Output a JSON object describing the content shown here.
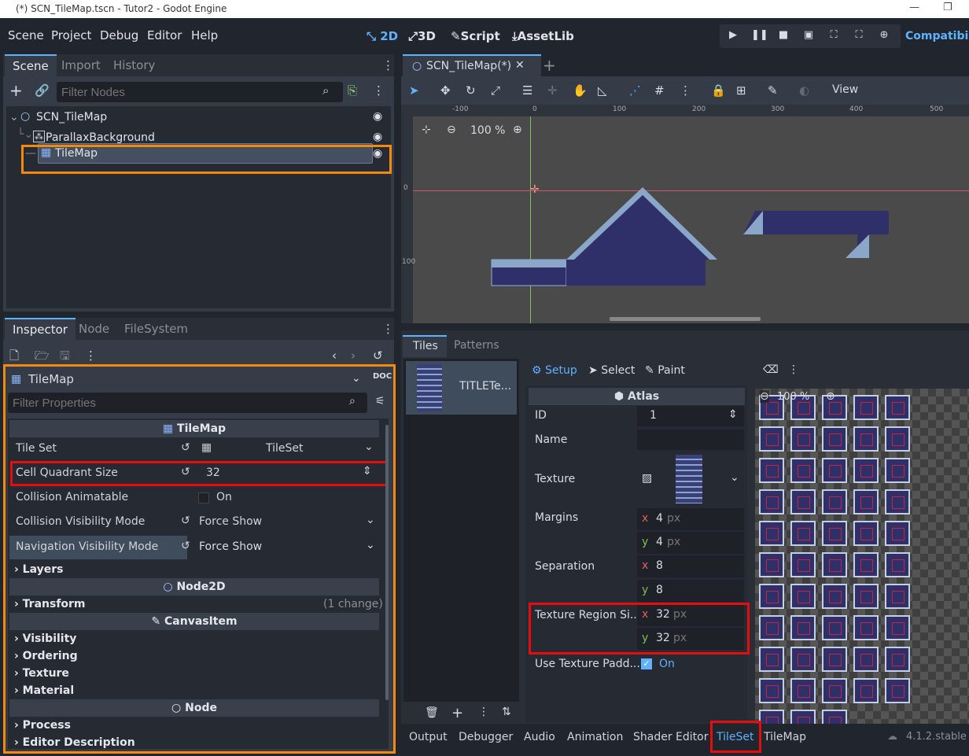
{
  "window": {
    "title": "(*) SCN_TileMap.tscn - Tutor2 - Godot Engine"
  },
  "menu": [
    "Scene",
    "Project",
    "Debug",
    "Editor",
    "Help"
  ],
  "workspaces": [
    "2D",
    "3D",
    "Script",
    "AssetLib"
  ],
  "renderer": "Compatibili",
  "scene_dock": {
    "tabs": [
      "Scene",
      "Import",
      "History"
    ],
    "filter_placeholder": "Filter Nodes",
    "tree": [
      "SCN_TileMap",
      "ParallaxBackground",
      "TileMap"
    ]
  },
  "inspector_dock": {
    "tabs": [
      "Inspector",
      "Node",
      "FileSystem"
    ],
    "object_name": "TileMap",
    "filter_placeholder": "Filter Properties",
    "section_tilemap": "TileMap",
    "props": {
      "tile_set_label": "Tile Set",
      "tile_set_value": "TileSet",
      "cell_quadrant_label": "Cell Quadrant Size",
      "cell_quadrant_value": "32",
      "collision_anim_label": "Collision Animatable",
      "collision_anim_value": "On",
      "collision_vis_label": "Collision Visibility Mode",
      "collision_vis_value": "Force Show",
      "nav_vis_label": "Navigation Visibility Mode",
      "nav_vis_value": "Force Show"
    },
    "groups": {
      "layers": "Layers",
      "node2d": "Node2D",
      "transform": "Transform",
      "transform_note": "(1 change)",
      "canvasitem": "CanvasItem",
      "visibility": "Visibility",
      "ordering": "Ordering",
      "texture": "Texture",
      "material": "Material",
      "node": "Node",
      "process": "Process",
      "editor_desc": "Editor Description"
    }
  },
  "viewport": {
    "tab": "SCN_TileMap(*)",
    "zoom": "100 %",
    "view_menu": "View",
    "ruler_x": [
      "-100",
      "0",
      "100",
      "200",
      "300",
      "400",
      "500"
    ],
    "ruler_y": [
      "0",
      "100"
    ]
  },
  "tileset_panel": {
    "tabs": [
      "Tiles",
      "Patterns"
    ],
    "source_name": "TITLETe...",
    "modes": [
      "Setup",
      "Select",
      "Paint"
    ],
    "atlas_header": "Atlas",
    "id_label": "ID",
    "id_value": "1",
    "name_label": "Name",
    "texture_label": "Texture",
    "margins_label": "Margins",
    "margins_x": "4",
    "margins_y": "4",
    "separation_label": "Separation",
    "separation_x": "8",
    "separation_y": "8",
    "region_label": "Texture Region Si...",
    "region_x": "32",
    "region_y": "32",
    "padding_label": "Use Texture Padd...",
    "padding_value": "On",
    "unit": "px",
    "atlas_zoom": "100 %"
  },
  "bottom_tabs": [
    "Output",
    "Debugger",
    "Audio",
    "Animation",
    "Shader Editor",
    "TileSet",
    "TileMap"
  ],
  "version": "4.1.2.stable"
}
